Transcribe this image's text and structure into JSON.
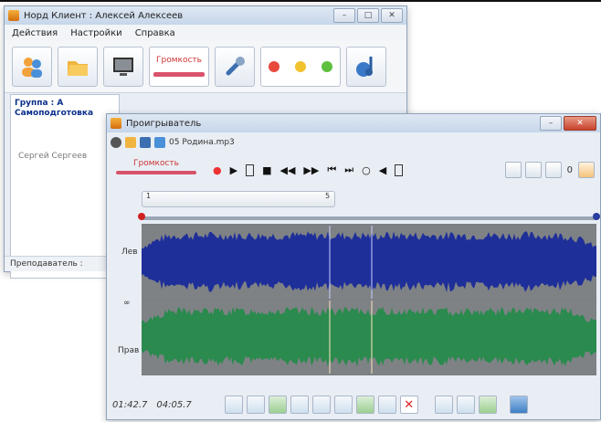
{
  "main_window": {
    "title": "Норд Клиент : Алексей Алексеев",
    "menu": [
      "Действия",
      "Настройки",
      "Справка"
    ],
    "volume_label": "Громкость",
    "group_title": "Группа : А",
    "group_name": "Самоподготовка",
    "member": "Сергей Сергеев",
    "status": "Преподаватель :",
    "colors": {
      "red": "#e74a3b",
      "yellow": "#f2c12e",
      "green": "#5fbf3f"
    }
  },
  "player": {
    "title": "Проигрыватель",
    "file": "05 Родина.mp3",
    "volume_label": "Громкость",
    "counter": "0",
    "slider_start": "1",
    "slider_end": "5",
    "left_channel": "Лев",
    "right_channel": "Прав",
    "zero": "∞",
    "time_current": "01:42.7",
    "time_total": "04:05.7",
    "transport": [
      "●",
      "▶",
      "■",
      "◀◀",
      "▶▶",
      "⏮",
      "⏭",
      "○",
      "◀"
    ],
    "colors": {
      "left_wave": "#1f2f99",
      "right_wave": "#2b8a4e"
    }
  }
}
